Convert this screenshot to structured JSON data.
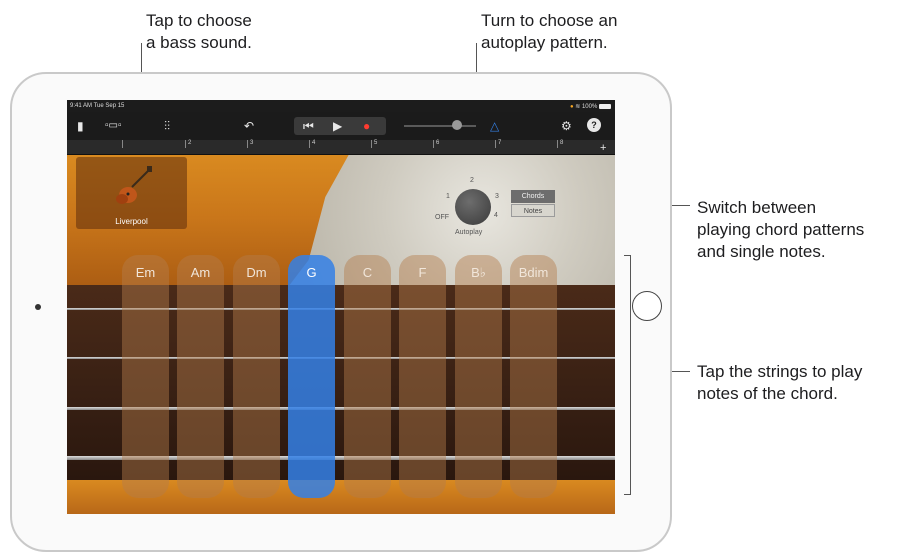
{
  "callouts": {
    "bass_sound": "Tap to choose\na bass sound.",
    "autoplay": "Turn to choose an\nautoplay pattern.",
    "switch": "Switch between\nplaying chord patterns\nand single notes.",
    "strings": "Tap the strings to play\nnotes of the chord."
  },
  "status_bar": {
    "time_date": "9:41 AM  Tue Sep 15",
    "battery": "100%"
  },
  "ruler": {
    "marks": [
      "2",
      "3",
      "4",
      "5",
      "6",
      "7",
      "8"
    ]
  },
  "instrument": {
    "name": "Liverpool",
    "icon": "bass-guitar-icon"
  },
  "autoplay": {
    "label": "Autoplay",
    "off": "OFF",
    "positions": [
      "1",
      "2",
      "3",
      "4"
    ]
  },
  "mode_switch": {
    "chords": "Chords",
    "notes": "Notes",
    "selected": "Chords"
  },
  "chords": [
    "Em",
    "Am",
    "Dm",
    "G",
    "C",
    "F",
    "B♭",
    "Bdim"
  ],
  "active_chord": "G",
  "colors": {
    "accent": "#3480e6",
    "record": "#ff3b30"
  }
}
